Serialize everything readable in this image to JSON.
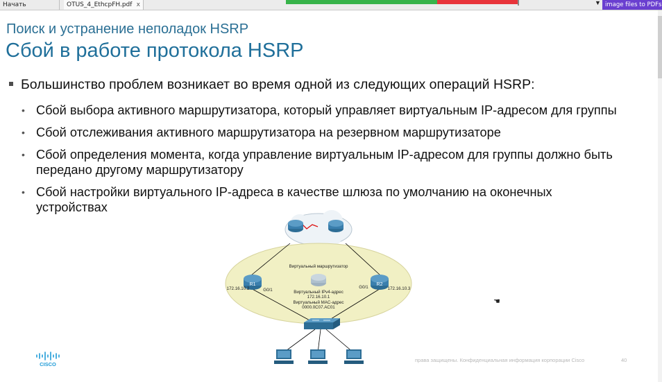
{
  "tabs": [
    {
      "label": "Начать"
    },
    {
      "label": "OTUS_4_EthcpFH.pdf",
      "close": "x"
    }
  ],
  "promo": {
    "label": "image files to PDFs"
  },
  "slide": {
    "subtitle": "Поиск и устранение неполадок HSRP",
    "title": "Сбой в работе протокола HSRP",
    "main_bullet": "Большинство проблем возникает во время одной из следующих операций HSRP:",
    "sub_bullets": [
      "Сбой выбора активного маршрутизатора, который управляет виртуальным IP-адресом для группы",
      "Сбой отслеживания активного маршрутизатора на резервном маршрутизаторе",
      "Сбой определения момента, когда управление виртуальным IP-адресом для группы должно быть передано другому маршрутизатору",
      "Сбой настройки виртуального IP-адреса в качестве шлюза по умолчанию на оконечных устройствах"
    ],
    "diagram": {
      "virtual_router_label": "Виртуальный маршрутизатор",
      "r1": {
        "name": "R1",
        "interface": "G0/1",
        "ip": "172.16.10.2"
      },
      "r2": {
        "name": "R2",
        "interface": "G0/1",
        "ip": "172.16.10.3"
      },
      "virtual_ip_label": "Виртуальный IPv4-адрес",
      "virtual_ip": "172.16.10.1",
      "virtual_mac_label": "Виртуальный MAC-адрес",
      "virtual_mac": "0000.0C07.AC01"
    },
    "logo_text": "CISCO",
    "footer": "права защищены. Конфиденциальная информация корпорации Cisco",
    "page_number": "40"
  },
  "colors": {
    "title": "#1f6f9a",
    "cloud_ellipse": "#f1f0c4",
    "router": "#2d6d95",
    "promo": "#6a3fd0"
  }
}
